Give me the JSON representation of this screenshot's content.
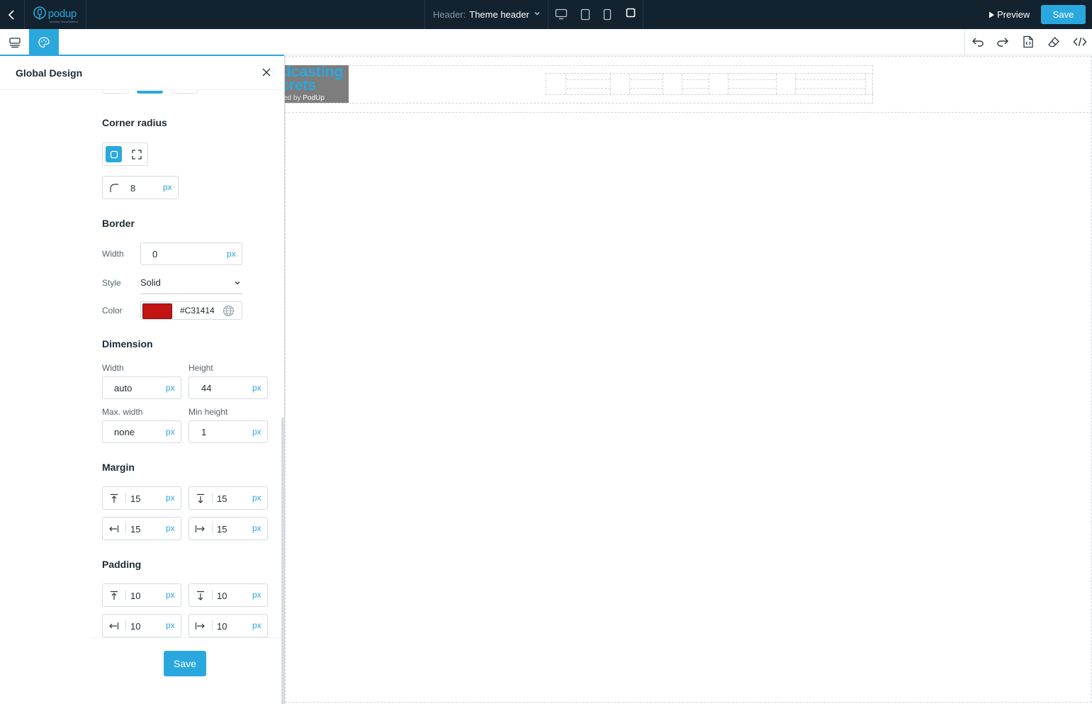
{
  "topbar": {
    "logo_text": "podup",
    "logo_subtext": "formerly ShowPlatform",
    "header_label": "Header:",
    "header_value": "Theme header",
    "preview_label": "Preview",
    "save_label": "Save",
    "devices": [
      "desktop-icon",
      "tablet-icon",
      "mobile-icon",
      "custom-size-icon"
    ]
  },
  "toolbar": {
    "left_icons": [
      "layers-icon",
      "palette-icon"
    ],
    "right_icons": [
      "undo-icon",
      "redo-icon",
      "file-code-icon",
      "eraser-icon",
      "code-icon"
    ]
  },
  "panel": {
    "title": "Global Design",
    "corner_radius": {
      "title": "Corner radius",
      "value": "8",
      "unit": "px"
    },
    "border": {
      "title": "Border",
      "width_label": "Width",
      "width_value": "0",
      "width_unit": "px",
      "style_label": "Style",
      "style_value": "Solid",
      "color_label": "Color",
      "color_value": "#C31414",
      "swatch": "#c31414"
    },
    "dimension": {
      "title": "Dimension",
      "width_label": "Width",
      "width_value": "auto",
      "width_unit": "px",
      "height_label": "Height",
      "height_value": "44",
      "height_unit": "px",
      "max_width_label": "Max. width",
      "max_width_value": "none",
      "max_width_unit": "px",
      "min_height_label": "Min height",
      "min_height_value": "1",
      "min_height_unit": "px"
    },
    "margin": {
      "title": "Margin",
      "top": "15",
      "bottom": "15",
      "left": "15",
      "right": "15",
      "unit": "px"
    },
    "padding": {
      "title": "Padding",
      "top": "10",
      "bottom": "10",
      "left": "10",
      "right": "10",
      "unit": "px"
    },
    "save_label": "Save"
  },
  "canvas": {
    "logo_line1": "dcasting",
    "logo_line2": "crets",
    "logo_line3_prefix": "ed by ",
    "logo_line3_brand": "PodUp"
  },
  "colors": {
    "accent": "#2aa8de",
    "topbar": "#13222f",
    "border_color": "#c31414"
  }
}
